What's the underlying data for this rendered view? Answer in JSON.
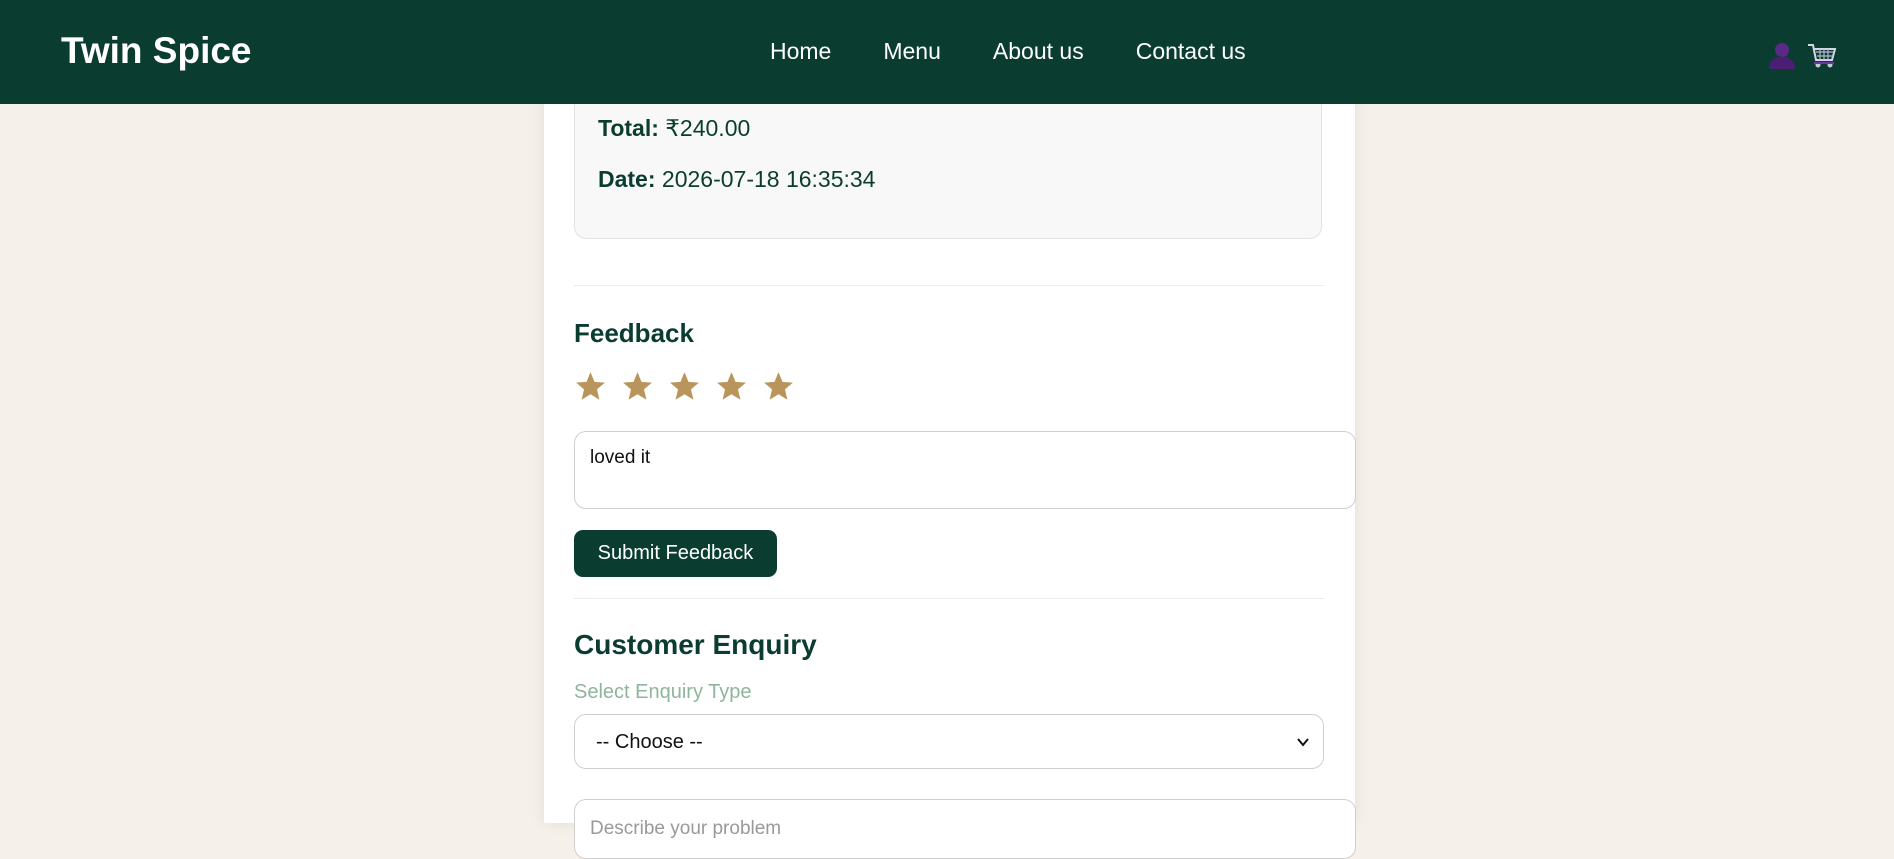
{
  "brand": "Twin Spice",
  "nav": [
    "Home",
    "Menu",
    "About us",
    "Contact us"
  ],
  "icons": {
    "user": "user-icon",
    "cart": "cart-icon"
  },
  "order": {
    "total_label": "Total:",
    "total_value": "₹240.00",
    "date_label": "Date:",
    "date_value": "2026-07-18 16:35:34"
  },
  "feedback": {
    "title": "Feedback",
    "rating": 5,
    "rating_max": 5,
    "comment": "loved it",
    "submit_label": "Submit Feedback"
  },
  "enquiry": {
    "title": "Customer Enquiry",
    "select_label": "Select Enquiry Type",
    "select_value": "-- Choose --",
    "problem_placeholder": "Describe your problem"
  },
  "colors": {
    "primary": "#0a3d2f",
    "background": "#f5f0e9",
    "star": "#b9955b",
    "label": "#8fb59d"
  }
}
